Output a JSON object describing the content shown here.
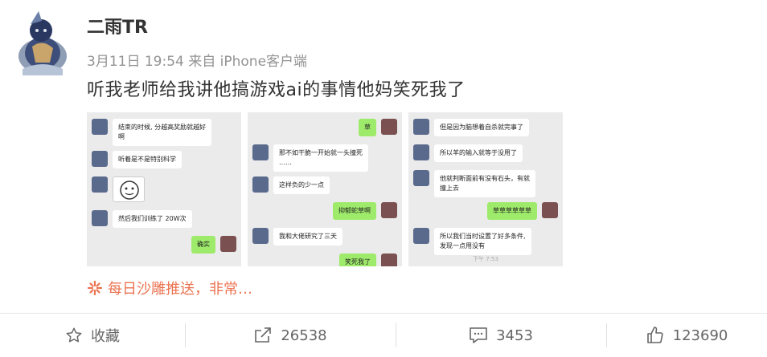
{
  "post": {
    "username": "二雨TR",
    "meta": "3月11日 19:54 来自 iPhone客户端",
    "content": "听我老师给我讲他搞游戏ai的事情他妈笑死我了",
    "topic": "每日沙雕推送，非常…"
  },
  "screenshots": [
    {
      "rows": [
        {
          "side": "l",
          "text": "结束的时候, 分越高奖励就越好\n啊"
        },
        {
          "side": "l",
          "text": "听着是不是特别科学"
        },
        {
          "side": "l",
          "text": "",
          "meme": true
        },
        {
          "side": "l",
          "text": "然后我们训练了 20W次"
        },
        {
          "side": "r",
          "text": "确实"
        }
      ]
    },
    {
      "rows": [
        {
          "side": "r",
          "text": "草"
        },
        {
          "side": "l",
          "text": "那不如干脆一开始就一头撞死\n……"
        },
        {
          "side": "l",
          "text": "这样负的少一点"
        },
        {
          "side": "r",
          "text": "抑郁蛇草啊"
        },
        {
          "side": "l",
          "text": "我和大佬研究了三天"
        },
        {
          "side": "r",
          "text": "笑死我了"
        }
      ]
    },
    {
      "rows": [
        {
          "side": "l",
          "text": "但是因为脑想着自杀就完事了"
        },
        {
          "side": "l",
          "text": "所以羊的输入就等于没用了"
        },
        {
          "side": "l",
          "text": "他就判断面前有没有石头，有就\n撞上去"
        },
        {
          "side": "r",
          "text": "草草草草草草"
        },
        {
          "side": "l",
          "text": "所以我们当时设置了好多条件,\n发现一点用没有"
        }
      ],
      "timestamp": "下午 7:53"
    }
  ],
  "actions": {
    "favorite": {
      "label": "收藏",
      "icon": "star-icon"
    },
    "repost": {
      "count": "26538",
      "icon": "share-icon"
    },
    "comment": {
      "count": "3453",
      "icon": "comment-icon"
    },
    "like": {
      "count": "123690",
      "icon": "thumbs-up-icon"
    }
  },
  "colors": {
    "topic": "#eb7350",
    "chat_bubble_green": "#9eea6a",
    "meta_gray": "#939393"
  }
}
